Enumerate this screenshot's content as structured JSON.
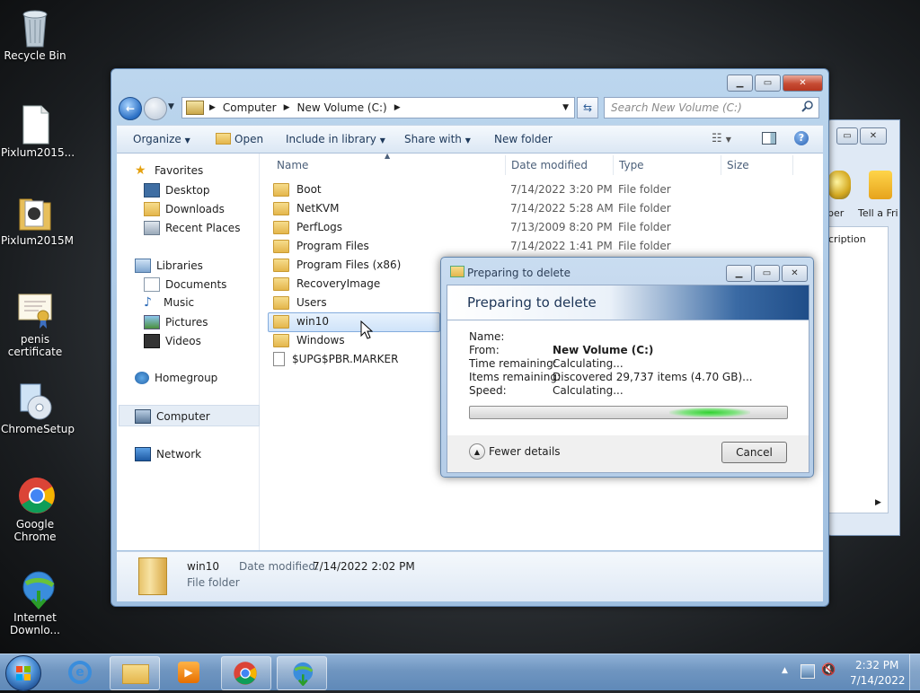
{
  "desktop": {
    "icons": [
      {
        "label": "Recycle Bin"
      },
      {
        "label": "Pixlum2015..."
      },
      {
        "label": "Pixlum2015M"
      },
      {
        "label": "penis certificate"
      },
      {
        "label": "ChromeSetup"
      },
      {
        "label": "Google Chrome"
      },
      {
        "label": "Internet Downlo..."
      }
    ]
  },
  "explorer": {
    "breadcrumb": [
      "Computer",
      "New Volume (C:)"
    ],
    "search_placeholder": "Search New Volume (C:)",
    "toolbar": {
      "organize": "Organize",
      "open": "Open",
      "include_in_library": "Include in library",
      "share_with": "Share with",
      "new_folder": "New folder"
    },
    "nav": {
      "favorites": "Favorites",
      "desktop": "Desktop",
      "downloads": "Downloads",
      "recent_places": "Recent Places",
      "libraries": "Libraries",
      "documents": "Documents",
      "music": "Music",
      "pictures": "Pictures",
      "videos": "Videos",
      "homegroup": "Homegroup",
      "computer": "Computer",
      "network": "Network"
    },
    "columns": {
      "name": "Name",
      "date_modified": "Date modified",
      "type": "Type",
      "size": "Size"
    },
    "files": [
      {
        "name": "Boot",
        "date": "7/14/2022 3:20 PM",
        "type": "File folder"
      },
      {
        "name": "NetKVM",
        "date": "7/14/2022 5:28 AM",
        "type": "File folder"
      },
      {
        "name": "PerfLogs",
        "date": "7/13/2009 8:20 PM",
        "type": "File folder"
      },
      {
        "name": "Program Files",
        "date": "7/14/2022 1:41 PM",
        "type": "File folder"
      },
      {
        "name": "Program Files (x86)",
        "date": "",
        "type": ""
      },
      {
        "name": "RecoveryImage",
        "date": "",
        "type": ""
      },
      {
        "name": "Users",
        "date": "",
        "type": ""
      },
      {
        "name": "win10",
        "date": "",
        "type": ""
      },
      {
        "name": "Windows",
        "date": "",
        "type": ""
      },
      {
        "name": "$UPG$PBR.MARKER",
        "date": "",
        "type": ""
      }
    ],
    "details": {
      "name": "win10",
      "date_label": "Date modified:",
      "date_value": "7/14/2022 2:02 PM",
      "type": "File folder"
    }
  },
  "dialog": {
    "title": "Preparing to delete",
    "heading": "Preparing to delete",
    "name_label": "Name:",
    "name_value": "",
    "from_label": "From:",
    "from_value": "New Volume (C:)",
    "time_label": "Time remaining:",
    "time_value": "Calculating...",
    "items_label": "Items remaining:",
    "items_value": "Discovered 29,737 items (4.70 GB)...",
    "speed_label": "Speed:",
    "speed_value": "Calculating...",
    "fewer_details": "Fewer details",
    "cancel": "Cancel"
  },
  "back_window": {
    "partial_1": "ber",
    "partial_2": "Tell a Fri",
    "partial_3": "cription"
  },
  "taskbar": {
    "time": "2:32 PM",
    "date": "7/14/2022"
  }
}
